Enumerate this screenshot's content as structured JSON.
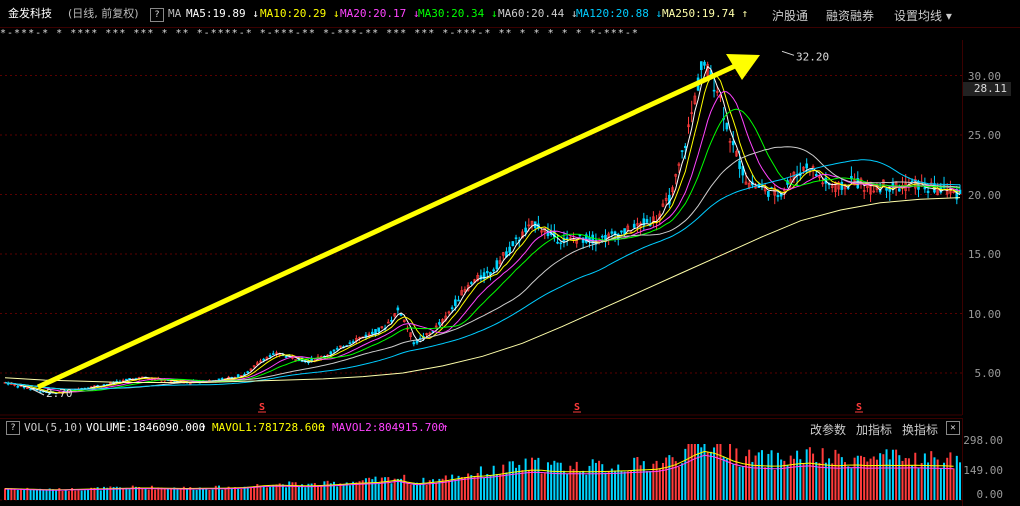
{
  "header": {
    "stock_name": "金发科技",
    "period": "(日线, 前复权)",
    "help_icon_label": "?",
    "ma_label": "MA",
    "ma_items": [
      {
        "label": "MA5:19.89",
        "arrow": "↓",
        "color": "#ffffff"
      },
      {
        "label": "MA10:20.29",
        "arrow": "↓",
        "color": "#ffff00"
      },
      {
        "label": "MA20:20.17",
        "arrow": "↓",
        "color": "#ff44ff"
      },
      {
        "label": "MA30:20.34",
        "arrow": "↓",
        "color": "#00ff00"
      },
      {
        "label": "MA60:20.44",
        "arrow": "↓",
        "color": "#cccccc"
      },
      {
        "label": "MA120:20.88",
        "arrow": "↓",
        "color": "#00ccff"
      },
      {
        "label": "MA250:19.74",
        "arrow": "↑",
        "color": "#ffffaa"
      }
    ],
    "tabs": [
      "沪股通",
      "融资融券",
      "设置均线 ▾"
    ]
  },
  "marks_row": "*-***-* *  **** *** *** * **  *-****-* *-***-** *-***-** ***  ***  *-***-* ** * * *  * * *-***-*",
  "annotations": {
    "high": "32.20",
    "low": "2.70",
    "current_price": "28.11",
    "s_marker": "S"
  },
  "y_axis": [
    "30.00",
    "25.00",
    "20.00",
    "15.00",
    "10.00",
    "5.00"
  ],
  "volume": {
    "help_icon_label": "?",
    "title": "VOL(5,10)",
    "volume_label": "VOLUME:1846090.000",
    "mavol1_label": "MAVOL1:781728.600",
    "mavol2_label": "MAVOL2:804915.700",
    "up_arrow": "↑",
    "tabs": [
      "改参数",
      "加指标",
      "换指标"
    ],
    "close_label": "✕",
    "y_axis": [
      "298.00",
      "149.00",
      "0.00"
    ]
  },
  "colors": {
    "up": "#ff3b3b",
    "down": "#00d4ff",
    "arrow": "#ffff00",
    "grid": "#5a0000"
  },
  "chart_data": {
    "type": "candlestick",
    "y_axis_ticks": [
      5,
      10,
      15,
      20,
      25,
      30
    ],
    "annotated_high": 32.2,
    "annotated_low": 2.7,
    "current_price": 28.11,
    "moving_averages": [
      {
        "name": "MA5",
        "value": 19.89
      },
      {
        "name": "MA10",
        "value": 20.29
      },
      {
        "name": "MA20",
        "value": 20.17
      },
      {
        "name": "MA30",
        "value": 20.34
      },
      {
        "name": "MA60",
        "value": 20.44
      },
      {
        "name": "MA120",
        "value": 20.88
      },
      {
        "name": "MA250",
        "value": 19.74
      }
    ],
    "price_path": [
      4.2,
      3.9,
      3.6,
      3.3,
      3.4,
      3.7,
      3.9,
      4.1,
      4.4,
      4.6,
      4.5,
      4.3,
      4.2,
      4.3,
      4.4,
      4.6,
      5.0,
      6.2,
      6.6,
      6.3,
      6.0,
      6.4,
      7.0,
      7.8,
      8.2,
      8.8,
      10.4,
      7.5,
      8.3,
      9.5,
      11.5,
      12.8,
      13.4,
      15.0,
      16.5,
      17.6,
      16.6,
      16.1,
      16.3,
      16.2,
      16.5,
      16.9,
      17.5,
      18.0,
      20.0,
      25.0,
      31.0,
      29.0,
      24.0,
      21.0,
      20.5,
      20.0,
      21.5,
      22.5,
      21.0,
      20.5,
      21.2,
      20.5,
      20.8,
      20.6,
      20.9,
      20.5,
      20.4,
      20.0
    ],
    "ma250_path": [
      4.6,
      4.4,
      4.3,
      4.2,
      4.2,
      4.2,
      4.3,
      4.4,
      4.5,
      4.7,
      5.0,
      5.6,
      6.4,
      7.5,
      8.9,
      10.4,
      11.9,
      13.4,
      14.9,
      16.4,
      17.8,
      18.7,
      19.3,
      19.6,
      19.74
    ],
    "volume_ylim": [
      0,
      298
    ]
  }
}
